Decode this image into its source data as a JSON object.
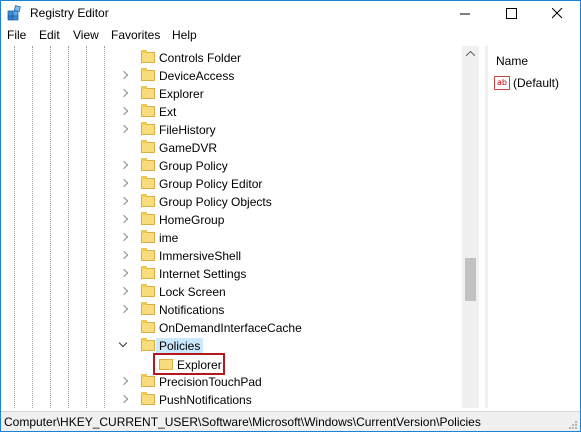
{
  "window": {
    "title": "Registry Editor",
    "accent_color": "#1883d7"
  },
  "menu": [
    "File",
    "Edit",
    "View",
    "Favorites",
    "Help"
  ],
  "tree": {
    "items": [
      {
        "label": "Controls Folder",
        "expander": "none"
      },
      {
        "label": "DeviceAccess",
        "expander": "collapsed"
      },
      {
        "label": "Explorer",
        "expander": "collapsed"
      },
      {
        "label": "Ext",
        "expander": "collapsed"
      },
      {
        "label": "FileHistory",
        "expander": "collapsed"
      },
      {
        "label": "GameDVR",
        "expander": "none"
      },
      {
        "label": "Group Policy",
        "expander": "collapsed"
      },
      {
        "label": "Group Policy Editor",
        "expander": "collapsed"
      },
      {
        "label": "Group Policy Objects",
        "expander": "collapsed"
      },
      {
        "label": "HomeGroup",
        "expander": "collapsed"
      },
      {
        "label": "ime",
        "expander": "collapsed"
      },
      {
        "label": "ImmersiveShell",
        "expander": "collapsed"
      },
      {
        "label": "Internet Settings",
        "expander": "collapsed"
      },
      {
        "label": "Lock Screen",
        "expander": "collapsed"
      },
      {
        "label": "Notifications",
        "expander": "collapsed"
      },
      {
        "label": "OnDemandInterfaceCache",
        "expander": "none"
      },
      {
        "label": "Policies",
        "expander": "expanded",
        "selected": true
      },
      {
        "label": "PrecisionTouchPad",
        "expander": "collapsed"
      },
      {
        "label": "PushNotifications",
        "expander": "collapsed"
      }
    ],
    "child": {
      "label": "Explorer",
      "highlight_color": "#b4171d"
    }
  },
  "values_pane": {
    "column_header": "Name",
    "rows": [
      {
        "name": "(Default)",
        "icon": "string-value-icon"
      }
    ]
  },
  "status": {
    "path": "Computer\\HKEY_CURRENT_USER\\Software\\Microsoft\\Windows\\CurrentVersion\\Policies"
  }
}
